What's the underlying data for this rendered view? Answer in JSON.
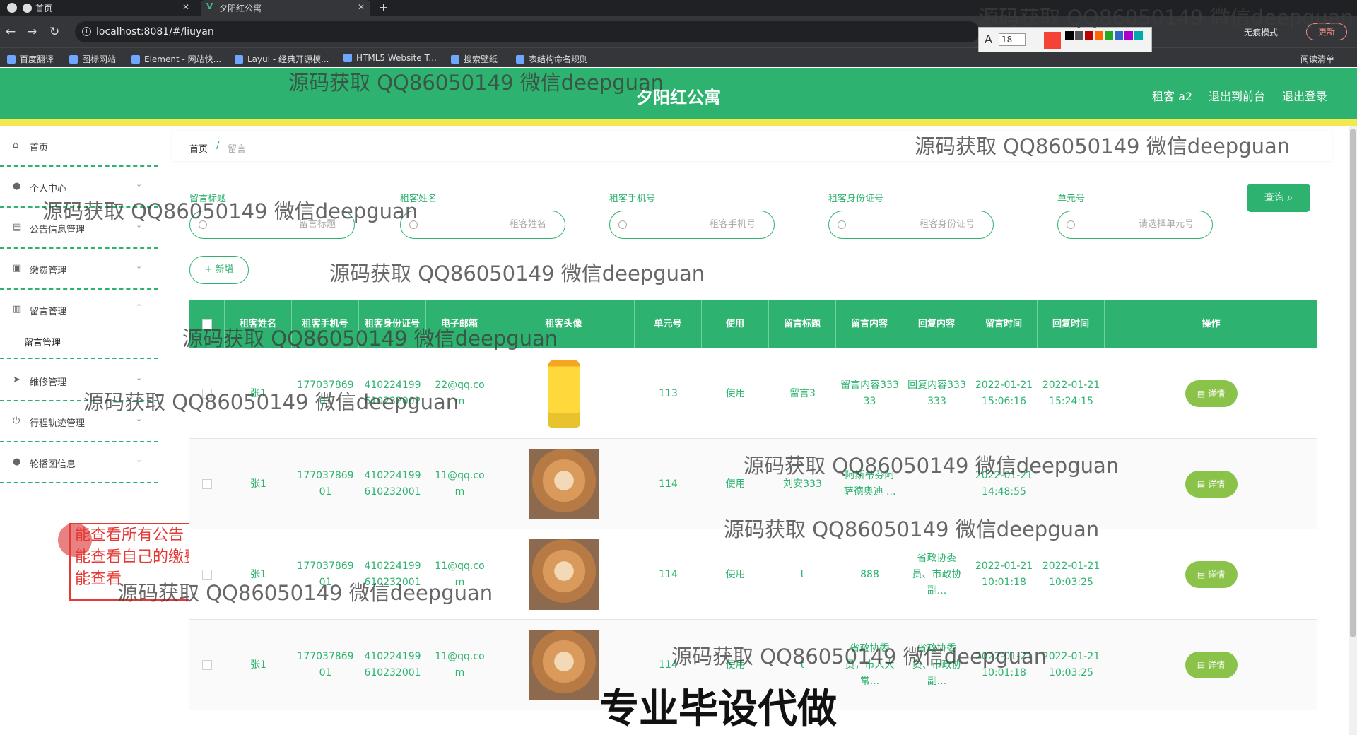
{
  "browser": {
    "tabs": [
      {
        "title": "首页",
        "active": false
      },
      {
        "title": "夕阳红公寓",
        "active": true
      }
    ],
    "url": "localhost:8081/#/liuyan",
    "incognito_label": "无痕模式",
    "update_label": "更新",
    "bookmarks": [
      "百度翻译",
      "图标网站",
      "Element - 网站快...",
      "Layui - 经典开源模...",
      "HTML5 Website T...",
      "搜索壁纸",
      "表结构命名规则"
    ],
    "reading_list": "阅读清单",
    "annot_size": "18",
    "annot_letter": "A"
  },
  "header": {
    "title": "夕阳红公寓",
    "nav": [
      "租客 a2",
      "退出到前台",
      "退出登录"
    ],
    "color": "#2db36f",
    "stripe_color": "#f2e94e"
  },
  "sidebar": {
    "items": [
      {
        "label": "首页",
        "icon": "home-icon"
      },
      {
        "label": "个人中心",
        "icon": "user-icon"
      },
      {
        "label": "公告信息管理",
        "icon": "folder-icon"
      },
      {
        "label": "缴费管理",
        "icon": "briefcase-icon"
      },
      {
        "label": "留言管理",
        "icon": "clipboard-icon"
      },
      {
        "label": "维修管理",
        "icon": "send-icon"
      },
      {
        "label": "行程轨迹管理",
        "icon": "power-icon"
      },
      {
        "label": "轮播图信息",
        "icon": "user-icon"
      }
    ],
    "submenu": "留言管理"
  },
  "annotation": [
    "能查看所有公告",
    "能查看自己的缴费",
    "能查看"
  ],
  "breadcrumb": {
    "home": "首页",
    "current": "留言"
  },
  "search": {
    "fields": [
      {
        "label": "留言标题",
        "placeholder": "留言标题"
      },
      {
        "label": "租客姓名",
        "placeholder": "租客姓名"
      },
      {
        "label": "租客手机号",
        "placeholder": "租客手机号"
      },
      {
        "label": "租客身份证号",
        "placeholder": "租客身份证号"
      },
      {
        "label": "单元号",
        "placeholder": "请选择单元号"
      }
    ],
    "query_label": "查询",
    "add_label": "+ 新增"
  },
  "table": {
    "headers": [
      "租客姓名",
      "租客手机号",
      "租客身份证号",
      "电子邮箱",
      "租客头像",
      "单元号",
      "使用",
      "留言标题",
      "留言内容",
      "回复内容",
      "留言时间",
      "回复时间",
      "操作"
    ],
    "detail_label": "详情",
    "rows": [
      {
        "name": "张1",
        "phone": "17703786901",
        "idcard": "410224199610232002",
        "email": "22@qq.com",
        "avatar": "oil-bottle",
        "unit": "113",
        "use": "使用",
        "title": "留言3",
        "content": "留言内容33333",
        "reply": "回复内容333333",
        "msg_time": "2022-01-21 15:06:16",
        "reply_time": "2022-01-21 15:24:15"
      },
      {
        "name": "张1",
        "phone": "17703786901",
        "idcard": "410224199610232001",
        "email": "11@qq.com",
        "avatar": "shiba-dog",
        "unit": "114",
        "use": "使用",
        "title": "刘安333",
        "content": "阿斯蒂芬阿萨德奥迪 ...",
        "reply": "",
        "msg_time": "2022-01-21 14:48:55",
        "reply_time": ""
      },
      {
        "name": "张1",
        "phone": "17703786901",
        "idcard": "410224199610232001",
        "email": "11@qq.com",
        "avatar": "shiba-dog",
        "unit": "114",
        "use": "使用",
        "title": "t",
        "content": "888",
        "reply": "省政协委员、市政协副...",
        "msg_time": "2022-01-21 10:01:18",
        "reply_time": "2022-01-21 10:03:25"
      },
      {
        "name": "张1",
        "phone": "17703786901",
        "idcard": "410224199610232001",
        "email": "11@qq.com",
        "avatar": "shiba-dog",
        "unit": "114",
        "use": "使用",
        "title": "t",
        "content": "省政协委员，市人大常...",
        "reply": "省政协委员、市政协副...",
        "msg_time": "2022-01-21 10:01:18",
        "reply_time": "2022-01-21 10:03:25"
      }
    ]
  },
  "watermark": "源码获取 QQ86050149 微信deepguan",
  "bottom_banner": "专业毕设代做"
}
